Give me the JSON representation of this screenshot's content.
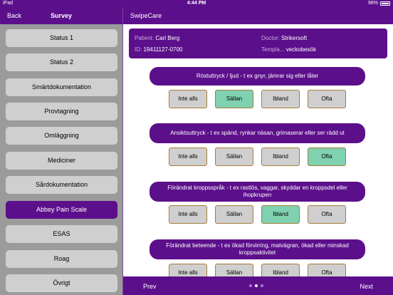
{
  "status_bar": {
    "device": "iPad",
    "time": "4:44 PM",
    "battery": "98%"
  },
  "sidebar": {
    "back_label": "Back",
    "title": "Survey",
    "items": [
      {
        "label": "Status 1",
        "active": false
      },
      {
        "label": "Status 2",
        "active": false
      },
      {
        "label": "Smärtdokumentation",
        "active": false
      },
      {
        "label": "Provtagning",
        "active": false
      },
      {
        "label": "Omläggning",
        "active": false
      },
      {
        "label": "Mediciner",
        "active": false
      },
      {
        "label": "Sårdokumentation",
        "active": false
      },
      {
        "label": "Abbey Pain Scale",
        "active": true
      },
      {
        "label": "ESAS",
        "active": false
      },
      {
        "label": "Roag",
        "active": false
      },
      {
        "label": "Övrigt",
        "active": false
      }
    ]
  },
  "header": {
    "title": "SwipeCare"
  },
  "patient": {
    "patient_label": "Patient:",
    "patient_value": "Carl Berg",
    "id_label": "ID:",
    "id_value": "19411127-0700",
    "doctor_label": "Doctor:",
    "doctor_value": "Strikersoft",
    "template_label": "Templa...",
    "template_value": "veckobesök"
  },
  "questions": [
    {
      "text": "Röstuttryck / ljud - t ex gnyr, jämrar sig eller låter",
      "options": [
        "Inte alls",
        "Sällan",
        "Ibland",
        "Ofta"
      ],
      "selected": 1
    },
    {
      "text": "Ansiktsuttryck - t ex spänd, rynkar näsan, grimaserar eller ser rädd ut",
      "options": [
        "Inte alls",
        "Sällan",
        "Ibland",
        "Ofta"
      ],
      "selected": 3
    },
    {
      "text": "Förändrat kroppsspråk - t ex rastlös, vaggar, skyddar en kroppsdel eller ihopkrupen",
      "options": [
        "Inte alls",
        "Sällan",
        "Ibland",
        "Ofta"
      ],
      "selected": 2
    },
    {
      "text": "Förändrat beteende - t ex ökad förvirring, matvägran, ökad eller minskad kroppsaktivitet",
      "options": [
        "Inte alls",
        "Sällan",
        "Ibland",
        "Ofta"
      ],
      "selected": -1
    }
  ],
  "footer": {
    "prev_label": "Prev",
    "next_label": "Next",
    "page_count": 3,
    "current_page": 2
  }
}
